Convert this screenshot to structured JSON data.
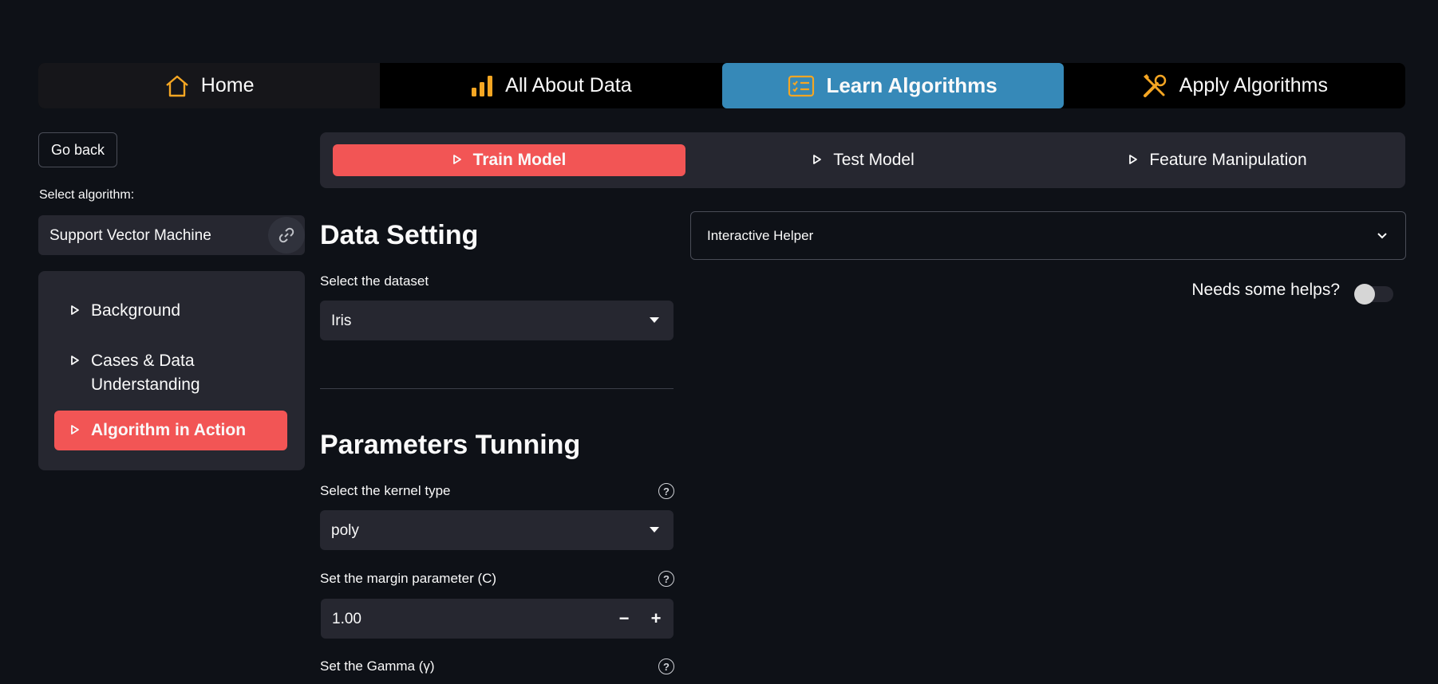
{
  "topnav": {
    "items": [
      {
        "label": "Home",
        "icon": "home-icon"
      },
      {
        "label": "All About Data",
        "icon": "bar-chart-icon"
      },
      {
        "label": "Learn Algorithms",
        "icon": "checklist-icon",
        "active": true
      },
      {
        "label": "Apply Algorithms",
        "icon": "tools-icon"
      }
    ],
    "accent_icon_color": "#f5a623",
    "active_color": "#3689b8"
  },
  "sidebar": {
    "go_back": "Go back",
    "select_label": "Select algorithm:",
    "selected_algorithm": "Support Vector Machine",
    "menu": [
      {
        "label": "Background"
      },
      {
        "label": "Cases & Data Understanding"
      },
      {
        "label": "Algorithm in Action",
        "active": true
      }
    ],
    "active_color": "#f25555"
  },
  "subtabs": [
    {
      "label": "Train Model",
      "active": true
    },
    {
      "label": "Test Model"
    },
    {
      "label": "Feature Manipulation"
    }
  ],
  "data_setting": {
    "title": "Data Setting",
    "dataset_label": "Select the dataset",
    "dataset_value": "Iris"
  },
  "parameters": {
    "title": "Parameters Tunning",
    "kernel_label": "Select the kernel type",
    "kernel_value": "poly",
    "margin_label": "Set the margin parameter (C)",
    "margin_value": "1.00",
    "minus": "−",
    "plus": "+",
    "gamma_label": "Set the Gamma (γ)",
    "help_glyph": "?"
  },
  "helper": {
    "title": "Interactive Helper",
    "toggle_label": "Needs some helps?",
    "toggle_on": false
  }
}
